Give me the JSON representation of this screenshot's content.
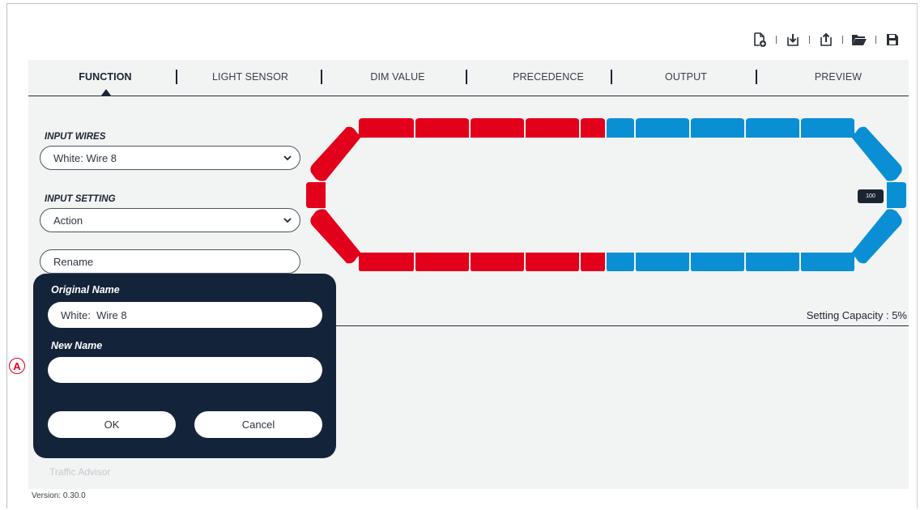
{
  "toolbar": {
    "buttons": [
      {
        "icon": "new-file-icon"
      },
      {
        "icon": "import-icon"
      },
      {
        "icon": "export-icon"
      },
      {
        "icon": "open-folder-icon"
      },
      {
        "icon": "save-icon"
      }
    ]
  },
  "tabs": {
    "items": [
      {
        "label": "FUNCTION",
        "active": true
      },
      {
        "label": "LIGHT SENSOR",
        "active": false
      },
      {
        "label": "DIM VALUE",
        "active": false
      },
      {
        "label": "PRECEDENCE",
        "active": false
      },
      {
        "label": "OUTPUT",
        "active": false
      },
      {
        "label": "PREVIEW",
        "active": false
      }
    ]
  },
  "form": {
    "input_wires_label": "INPUT WIRES",
    "input_wires_value": "White:  Wire 8",
    "input_setting_label": "INPUT SETTING",
    "input_setting_value": "Action",
    "rename_label": "Rename"
  },
  "lightbar": {
    "left_color": "#e3001b",
    "right_color": "#0b8fd4",
    "badge_value": "100"
  },
  "capacity": {
    "text": "Setting Capacity  : 5%"
  },
  "dialog": {
    "original_name_label": "Original Name",
    "original_name_value": "White:  Wire 8",
    "new_name_label": "New Name",
    "new_name_value": "",
    "ok_label": "OK",
    "cancel_label": "Cancel"
  },
  "marker": {
    "label": "A",
    "color": "#e0001a"
  },
  "footer": {
    "hidden_item": "Traffic Advisor",
    "version": "Version: 0.30.0"
  },
  "colors": {
    "dark_navy": "#13243a",
    "work_bg": "#f2f3f3"
  }
}
